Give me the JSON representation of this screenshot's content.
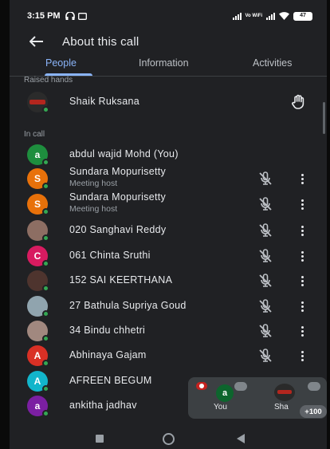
{
  "status_bar": {
    "time": "3:15 PM",
    "volte_label": "Vo WiFi",
    "battery": "47"
  },
  "app_bar": {
    "back_icon": "arrow-back-icon",
    "title": "About this call"
  },
  "tabs": [
    {
      "label": "People",
      "active": true
    },
    {
      "label": "Information",
      "active": false
    },
    {
      "label": "Activities",
      "active": false
    }
  ],
  "raised_hands": {
    "label": "Raised hands",
    "participants": [
      {
        "name": "Shaik Ruksana",
        "icon": "raised-hand-icon"
      }
    ]
  },
  "in_call": {
    "label": "In call",
    "participants": [
      {
        "name": "abdul wajid Mohd (You)",
        "initial": "a",
        "color": "#1e8e3e",
        "subtitle": "",
        "mic_off": false,
        "more": false
      },
      {
        "name": "Sundara Mopurisetty",
        "initial": "S",
        "color": "#e8710a",
        "subtitle": "Meeting host",
        "mic_off": true,
        "more": true
      },
      {
        "name": "Sundara Mopurisetty",
        "initial": "S",
        "color": "#e8710a",
        "subtitle": "Meeting host",
        "mic_off": true,
        "more": true
      },
      {
        "name": "020 Sanghavi Reddy",
        "initial": "",
        "color": "#8d6e63",
        "subtitle": "",
        "mic_off": true,
        "more": true,
        "photo": true
      },
      {
        "name": "061 Chinta Sruthi",
        "initial": "C",
        "color": "#d81b60",
        "subtitle": "",
        "mic_off": true,
        "more": true
      },
      {
        "name": "152 SAI KEERTHANA",
        "initial": "",
        "color": "#4e342e",
        "subtitle": "",
        "mic_off": true,
        "more": true,
        "photo": true
      },
      {
        "name": "27 Bathula Supriya Goud",
        "initial": "",
        "color": "#90a4ae",
        "subtitle": "",
        "mic_off": true,
        "more": true,
        "photo": true
      },
      {
        "name": "34 Bindu chhetri",
        "initial": "",
        "color": "#a1887f",
        "subtitle": "",
        "mic_off": true,
        "more": true,
        "photo": true
      },
      {
        "name": "Abhinaya Gajam",
        "initial": "A",
        "color": "#d93025",
        "subtitle": "",
        "mic_off": true,
        "more": true
      },
      {
        "name": "AFREEN BEGUM",
        "initial": "A",
        "color": "#12b5cb",
        "subtitle": "",
        "mic_off": false,
        "more": false
      },
      {
        "name": "ankitha jadhav",
        "initial": "a",
        "color": "#7b1fa2",
        "subtitle": "",
        "mic_off": false,
        "more": false
      }
    ]
  },
  "pip": {
    "you_label": "You",
    "you_initial": "a",
    "other_label": "Sha",
    "badge": "+100"
  }
}
